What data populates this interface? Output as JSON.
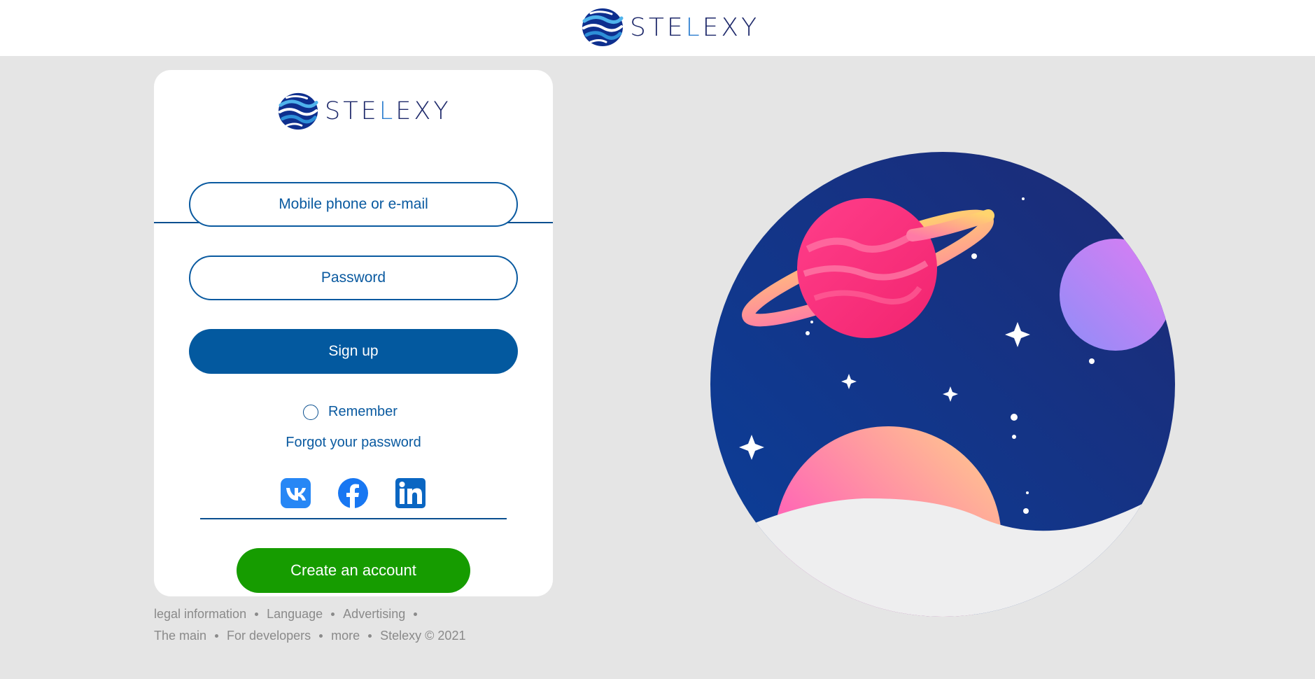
{
  "header": {
    "brand": {
      "part1": "STE",
      "part2": "L",
      "part3": "EXY",
      "logo_icon": "stelexy-globe-logo"
    }
  },
  "card": {
    "brand": {
      "part1": "STE",
      "part2": "L",
      "part3": "EXY"
    },
    "login_field": {
      "placeholder": "Mobile phone or e-mail"
    },
    "password_field": {
      "placeholder": "Password"
    },
    "signup_button": "Sign up",
    "remember_label": "Remember",
    "forgot_link": "Forgot your password",
    "socials": [
      {
        "name": "vk-icon",
        "color": "#2787f5"
      },
      {
        "name": "facebook-icon",
        "color": "#1877f2"
      },
      {
        "name": "linkedin-icon",
        "color": "#0a66c2"
      }
    ],
    "create_account_button": "Create an account"
  },
  "footer": {
    "row1": [
      "legal information",
      "Language",
      "Advertising"
    ],
    "row2": [
      "The main",
      "For developers",
      "more",
      "Stelexy © 2021"
    ]
  },
  "colors": {
    "accent": "#03599f",
    "create": "#169c00",
    "page_bg": "#e5e5e5"
  }
}
